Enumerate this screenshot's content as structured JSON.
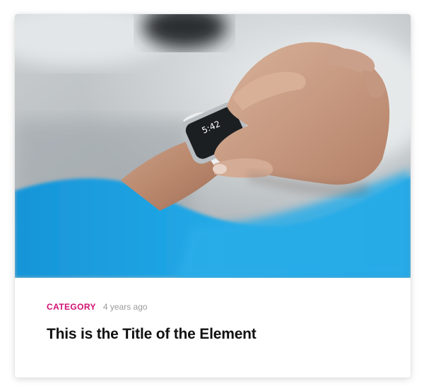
{
  "card": {
    "image_alt": "Person checking a smartwatch on their wrist",
    "watch_time": "5:42",
    "category": "CATEGORY",
    "time_ago": "4 years ago",
    "title": "This is the Title of the Element"
  },
  "colors": {
    "category": "#d10f73",
    "meta_text": "#9a9a9a",
    "title_text": "#111111",
    "sleeve": "#1ea0de"
  }
}
